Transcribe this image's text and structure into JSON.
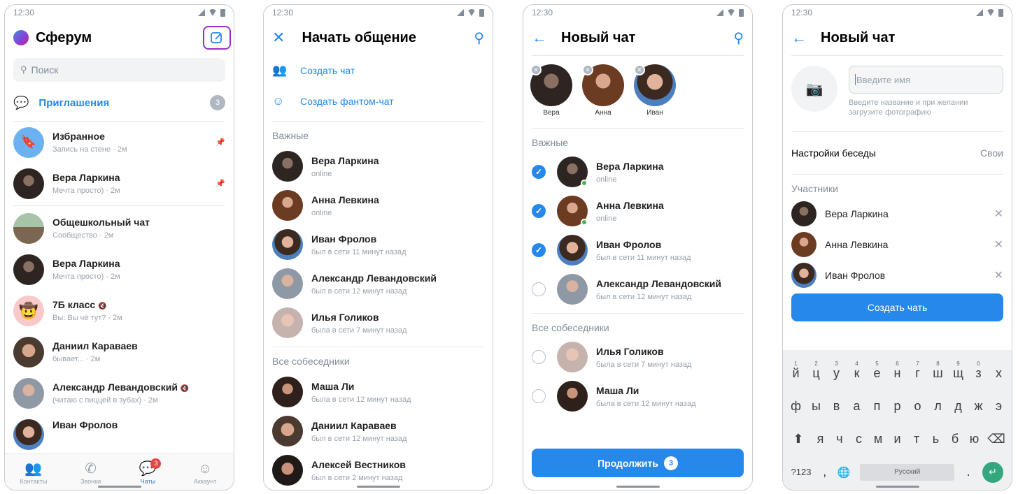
{
  "status_time": "12:30",
  "colors": {
    "accent": "#2688eb",
    "highlight": "#9b30c8",
    "badge_red": "#e64646",
    "online": "#4bb34b"
  },
  "screen1": {
    "app_name": "Сферум",
    "search_placeholder": "Поиск",
    "invites_label": "Приглашения",
    "invites_count": "3",
    "chats": [
      {
        "name": "Избранное",
        "preview": "Запись на стене",
        "time": "2м"
      },
      {
        "name": "Вера Ларкина",
        "preview": "Мечта просто)",
        "time": "2м"
      },
      {
        "name": "Общешкольный чат",
        "preview": "Сообщество",
        "time": "2м"
      },
      {
        "name": "Вера Ларкина",
        "preview": "Мечта просто)",
        "time": "2м"
      },
      {
        "name": "7Б класс",
        "preview": "Вы: Вы чё тут?",
        "time": "2м"
      },
      {
        "name": "Даниил Караваев",
        "preview": "бывает...",
        "time": "2м"
      },
      {
        "name": "Александр Левандовский",
        "preview": "(читаю с пиццей в зубах)",
        "time": "2м"
      },
      {
        "name": "Иван Фролов",
        "preview": "",
        "time": ""
      }
    ],
    "tabs": [
      {
        "label": "Контакты",
        "icon": "contacts-icon"
      },
      {
        "label": "Звонки",
        "icon": "phone-icon"
      },
      {
        "label": "Чаты",
        "icon": "chat-icon"
      },
      {
        "label": "Аккаунт",
        "icon": "account-icon"
      }
    ],
    "chats_badge": "3"
  },
  "screen2": {
    "title": "Начать общение",
    "create_chat": "Создать чат",
    "create_phantom": "Создать фантом-чат",
    "section_important": "Важные",
    "section_all": "Все собеседники",
    "important": [
      {
        "name": "Вера Ларкина",
        "status": "online"
      },
      {
        "name": "Анна Левкина",
        "status": "online"
      },
      {
        "name": "Иван Фролов",
        "status": "был в сети 11 минут назад"
      },
      {
        "name": "Александр Левандовский",
        "status": "был в сети 12 минут назад"
      },
      {
        "name": "Илья Голиков",
        "status": "была в сети 7 минут назад"
      }
    ],
    "all": [
      {
        "name": "Маша Ли",
        "status": "была в сети 12 минут назад"
      },
      {
        "name": "Даниил Караваев",
        "status": "был в сети 12 минут назад"
      },
      {
        "name": "Алексей Вестников",
        "status": "был в сети 2 минут назад"
      }
    ]
  },
  "screen3": {
    "title": "Новый чат",
    "selected": [
      {
        "name": "Вера"
      },
      {
        "name": "Анна"
      },
      {
        "name": "Иван"
      }
    ],
    "section_important": "Важные",
    "section_all": "Все собеседники",
    "important": [
      {
        "name": "Вера Ларкина",
        "status": "online"
      },
      {
        "name": "Анна Левкина",
        "status": "online"
      },
      {
        "name": "Иван Фролов",
        "status": "был в сети 11 минут назад"
      },
      {
        "name": "Александр Левандовский",
        "status": "был в сети 12 минут назад"
      }
    ],
    "all": [
      {
        "name": "Илья Голиков",
        "status": "была в сети 7 минут назад"
      },
      {
        "name": "Маша Ли",
        "status": "была в сети 12 минут назад"
      }
    ],
    "continue_label": "Продолжить",
    "continue_count": "3"
  },
  "screen4": {
    "title": "Новый чат",
    "name_placeholder": "Введите имя",
    "hint": "Введите название и при желании загрузите фотографию",
    "settings_label": "Настройки беседы",
    "settings_value": "Свои",
    "members_label": "Участники",
    "members": [
      {
        "name": "Вера Ларкина"
      },
      {
        "name": "Анна Левкина"
      },
      {
        "name": "Иван Фролов"
      }
    ],
    "create_label": "Создать чать",
    "keyboard": {
      "row1": [
        "й",
        "ц",
        "у",
        "к",
        "е",
        "н",
        "г",
        "ш",
        "щ",
        "з",
        "х"
      ],
      "row1_hints": [
        "1",
        "2",
        "3",
        "4",
        "5",
        "6",
        "7",
        "8",
        "9",
        "0",
        ""
      ],
      "row2": [
        "ф",
        "ы",
        "в",
        "а",
        "п",
        "р",
        "о",
        "л",
        "д",
        "ж",
        "э"
      ],
      "row3": [
        "я",
        "ч",
        "с",
        "м",
        "и",
        "т",
        "ь",
        "б",
        "ю"
      ],
      "sym_label": "?123",
      "space_label": "Русский",
      "period": ".",
      "comma": ","
    }
  }
}
